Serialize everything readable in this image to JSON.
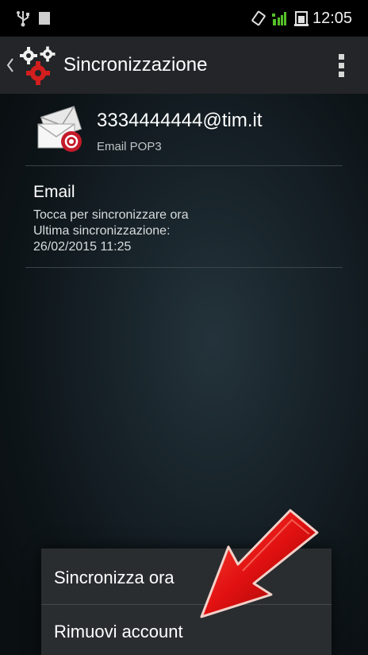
{
  "status_bar": {
    "time": "12:05",
    "icons": [
      "usb-icon",
      "image-icon",
      "rotate-icon",
      "signal-icon",
      "battery-icon"
    ]
  },
  "action_bar": {
    "title": "Sincronizzazione",
    "icons": [
      "chevron-left-icon",
      "gears-icon",
      "overflow-menu-icon"
    ]
  },
  "account": {
    "address": "3334444444@tim.it",
    "type": "Email POP3",
    "icon": "email-account-icon"
  },
  "sync_item": {
    "title": "Email",
    "hint": "Tocca per sincronizzare ora",
    "last_sync_label": "Ultima sincronizzazione:",
    "last_sync_date": "26/02/2015 11:25"
  },
  "popup_menu": {
    "items": [
      {
        "label": "Sincronizza ora"
      },
      {
        "label": "Rimuovi account"
      }
    ]
  },
  "colors": {
    "accent_arrow": "#e01010",
    "action_bar": "#232528",
    "background": "#162127",
    "menu": "#2a2d30",
    "signal_green": "#55c02a"
  }
}
